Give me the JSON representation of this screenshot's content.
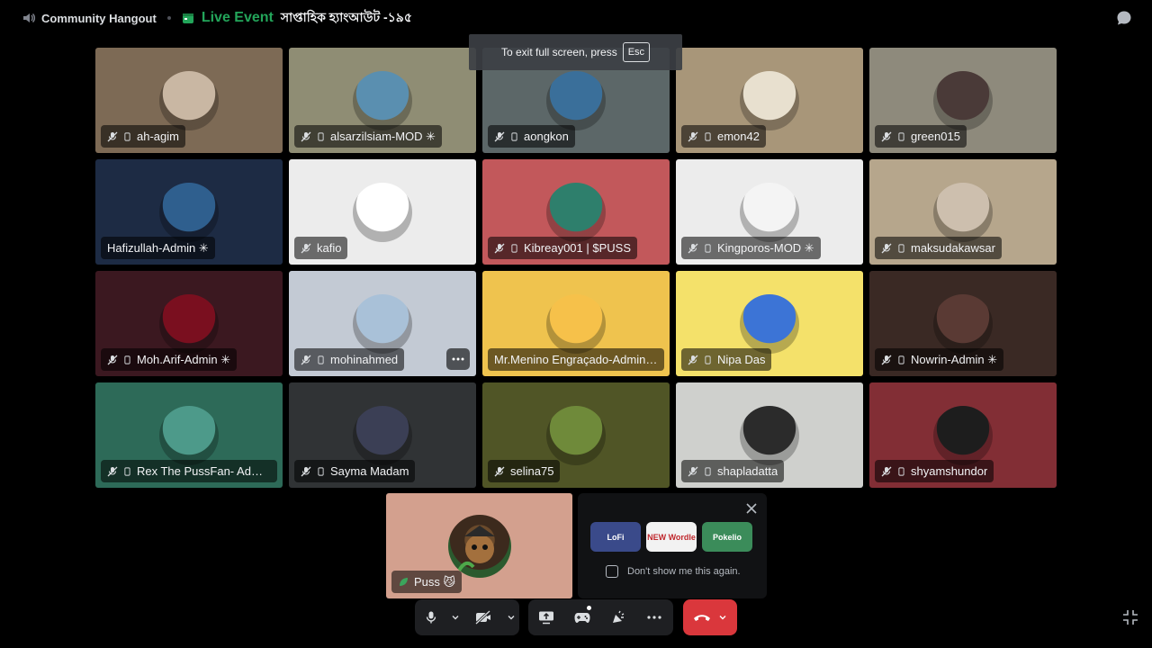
{
  "topbar": {
    "channel": "Community Hangout",
    "live_label": "Live Event",
    "event_name": "সাপ্তাহিক হ্যাংআউট -১৯৫"
  },
  "exit_tip": {
    "text": "To exit full screen, press",
    "key": "Esc"
  },
  "participants": [
    {
      "name": "ah-agim",
      "bg": "#7d6a55",
      "av": "#c9b7a3",
      "muted": true,
      "phone": true
    },
    {
      "name": "alsarzilsiam-MOD ✳",
      "bg": "#8f8d74",
      "av": "#5a8fb0",
      "muted": true,
      "phone": true
    },
    {
      "name": "aongkon",
      "bg": "#5c6768",
      "av": "#3a6f9a",
      "muted": true,
      "phone": true
    },
    {
      "name": "emon42",
      "bg": "#a89679",
      "av": "#e8e0cf",
      "muted": true,
      "phone": true
    },
    {
      "name": "green015",
      "bg": "#8e8a7c",
      "av": "#4a3a38",
      "muted": true,
      "phone": true
    },
    {
      "name": "Hafizullah-Admin ✳",
      "bg": "#1d2b44",
      "av": "#2f5f8e",
      "muted": false,
      "phone": false
    },
    {
      "name": "kafio",
      "bg": "#ececec",
      "av": "#ffffff",
      "muted": true,
      "phone": false
    },
    {
      "name": "Kibreay001 | $PUSS",
      "bg": "#c2585b",
      "av": "#2e7f6c",
      "muted": true,
      "phone": true
    },
    {
      "name": "Kingporos-MOD ✳",
      "bg": "#ececec",
      "av": "#f4f4f4",
      "muted": true,
      "phone": true
    },
    {
      "name": "maksudakawsar",
      "bg": "#b6a68c",
      "av": "#cdbfae",
      "muted": true,
      "phone": true
    },
    {
      "name": "Moh.Arif-Admin ✳",
      "bg": "#3b1820",
      "av": "#7a0f1f",
      "muted": true,
      "phone": true
    },
    {
      "name": "mohinahmed",
      "bg": "#c3cad4",
      "av": "#a9c1d8",
      "muted": true,
      "phone": true
    },
    {
      "name": "Mr.Menino Engraçado-Admin ✳",
      "bg": "#efc34e",
      "av": "#f6c14a",
      "muted": false,
      "phone": false
    },
    {
      "name": "Nipa Das",
      "bg": "#f4e16a",
      "av": "#3c74d6",
      "muted": true,
      "phone": true
    },
    {
      "name": "Nowrin-Admin ✳",
      "bg": "#3a2924",
      "av": "#5a3a34",
      "muted": true,
      "phone": true
    },
    {
      "name": "Rex The PussFan- Admi...",
      "bg": "#2d6a58",
      "av": "#4d9a8a",
      "muted": true,
      "phone": true
    },
    {
      "name": "Sayma Madam",
      "bg": "#303335",
      "av": "#3b3f55",
      "muted": true,
      "phone": true
    },
    {
      "name": "selina75",
      "bg": "#505526",
      "av": "#6f8a3a",
      "muted": true,
      "phone": false
    },
    {
      "name": "shapladatta",
      "bg": "#cfd0cd",
      "av": "#2b2b2b",
      "muted": true,
      "phone": true
    },
    {
      "name": "shyamshundor",
      "bg": "#822e35",
      "av": "#1d1d1d",
      "muted": true,
      "phone": true
    }
  ],
  "self": {
    "name": "Puss 😼",
    "bg": "#d3a08e"
  },
  "activity_popup": {
    "activities": [
      {
        "label": "LoFi",
        "bg": "#3a4a8a"
      },
      {
        "label": "NEW Wordle",
        "bg": "#f2f2f2"
      },
      {
        "label": "Pokelio",
        "bg": "#3b8c5a"
      }
    ],
    "option_label": "Don't show me this again."
  },
  "colors": {
    "accent_green": "#23a55a",
    "hangup_red": "#da373c",
    "bar_bg": "#1e1f22"
  }
}
